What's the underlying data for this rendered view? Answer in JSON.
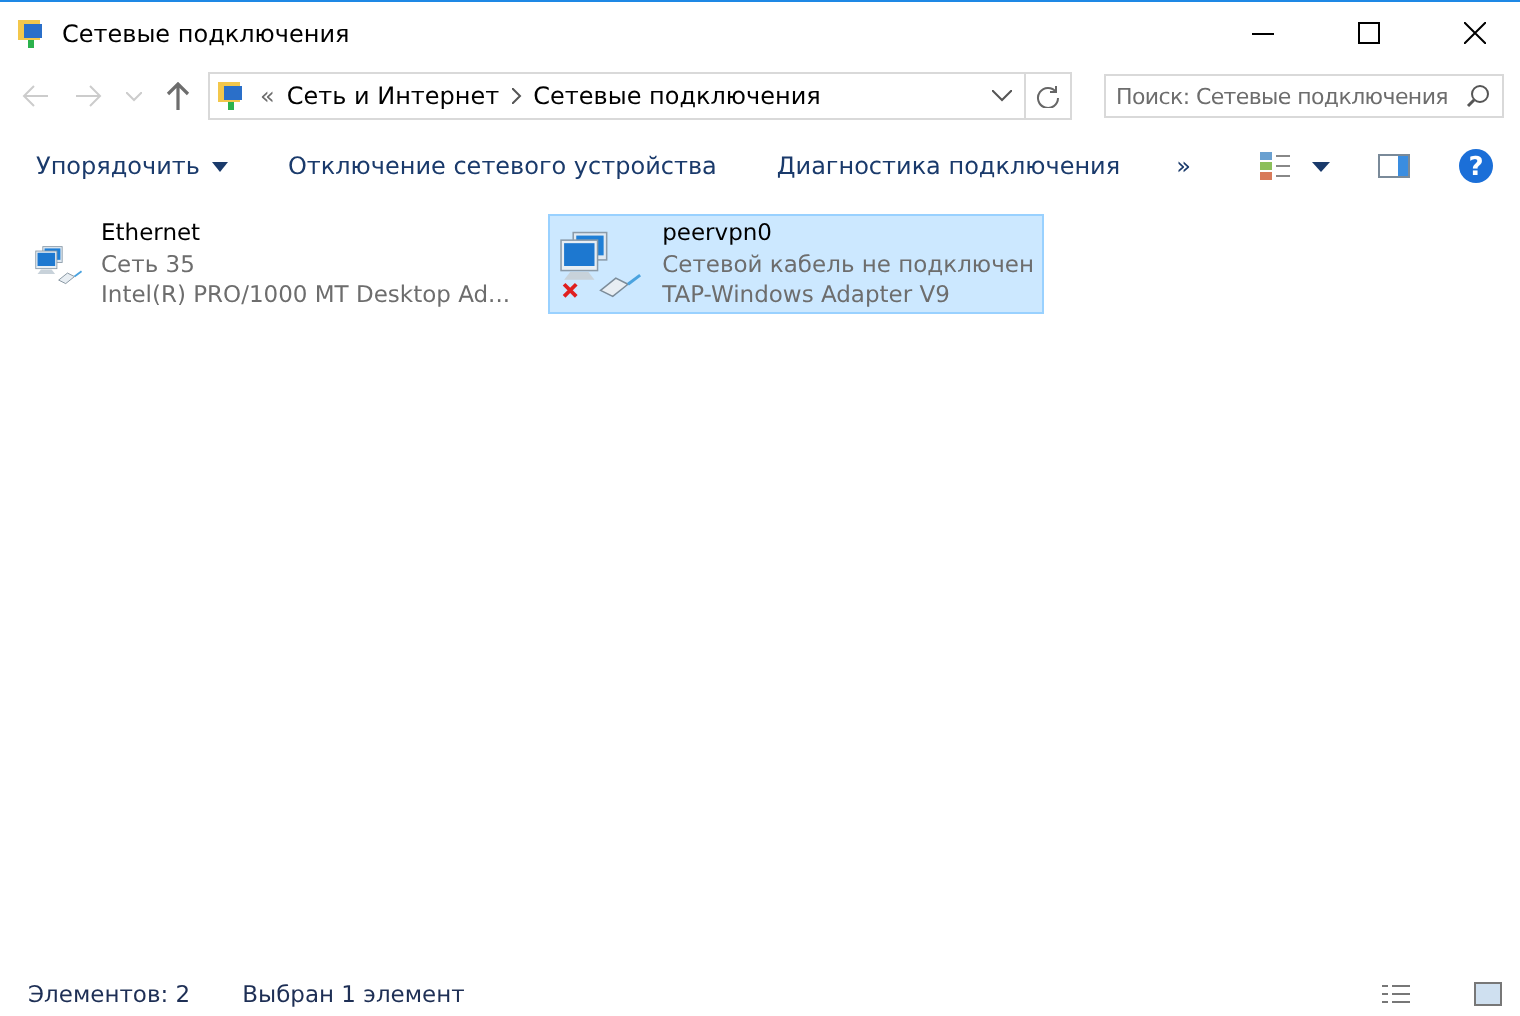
{
  "window": {
    "title": "Сетевые подключения"
  },
  "address": {
    "overflow": "«",
    "crumbs": [
      "Сеть и Интернет",
      "Сетевые подключения"
    ]
  },
  "search": {
    "placeholder": "Поиск: Сетевые подключения"
  },
  "commands": [
    {
      "label": "Упорядочить",
      "dropdown": true
    },
    {
      "label": "Отключение сетевого устройства",
      "dropdown": false
    },
    {
      "label": "Диагностика подключения",
      "dropdown": false
    }
  ],
  "more": "»",
  "help": "?",
  "connections": [
    {
      "name": "Ethernet",
      "status": "Сеть  35",
      "device": "Intel(R) PRO/1000 MT Desktop Ad...",
      "disconnected": false,
      "selected": false
    },
    {
      "name": "peervpn0",
      "status": "Сетевой кабель не подключен",
      "device": "TAP-Windows Adapter V9",
      "disconnected": true,
      "selected": true
    }
  ],
  "status_bar": {
    "count": "Элементов: 2",
    "selection": "Выбран 1 элемент"
  }
}
